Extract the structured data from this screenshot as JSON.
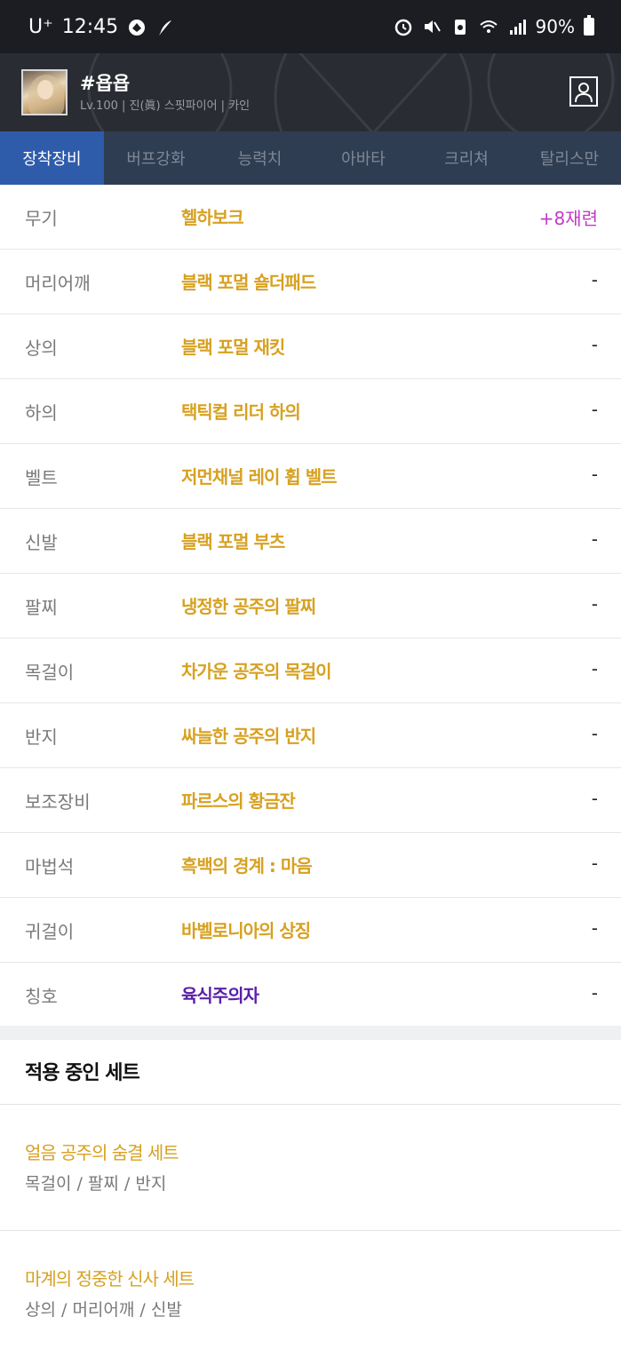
{
  "status_bar": {
    "carrier": "U⁺",
    "time": "12:45",
    "battery": "90%",
    "icons": [
      "signal-app-icon",
      "feather-icon",
      "alarm-icon",
      "mute-icon",
      "battery-saver-icon",
      "wifi-icon",
      "cell-signal-icon",
      "battery-icon"
    ]
  },
  "profile": {
    "name": "#욥욥",
    "info": "Lv.100 | 진(眞) 스핏파이어 | 카인"
  },
  "tabs": [
    {
      "label": "장착장비",
      "active": true
    },
    {
      "label": "버프강화",
      "active": false
    },
    {
      "label": "능력치",
      "active": false
    },
    {
      "label": "아바타",
      "active": false
    },
    {
      "label": "크리쳐",
      "active": false
    },
    {
      "label": "탈리스만",
      "active": false
    }
  ],
  "equipment": [
    {
      "slot": "무기",
      "item": "헬하보크",
      "tail": "+8재련"
    },
    {
      "slot": "머리어깨",
      "item": "블랙 포멀 숄더패드",
      "tail": "-"
    },
    {
      "slot": "상의",
      "item": "블랙 포멀 재킷",
      "tail": "-"
    },
    {
      "slot": "하의",
      "item": "택틱컬 리더 하의",
      "tail": "-"
    },
    {
      "slot": "벨트",
      "item": "저먼채널 레이 휩 벨트",
      "tail": "-"
    },
    {
      "slot": "신발",
      "item": "블랙 포멀 부츠",
      "tail": "-"
    },
    {
      "slot": "팔찌",
      "item": "냉정한 공주의 팔찌",
      "tail": "-"
    },
    {
      "slot": "목걸이",
      "item": "차가운 공주의 목걸이",
      "tail": "-"
    },
    {
      "slot": "반지",
      "item": "싸늘한 공주의 반지",
      "tail": "-"
    },
    {
      "slot": "보조장비",
      "item": "파르스의 황금잔",
      "tail": "-"
    },
    {
      "slot": "마법석",
      "item": "흑백의 경계 : 마음",
      "tail": "-"
    },
    {
      "slot": "귀걸이",
      "item": "바벨로니아의 상징",
      "tail": "-"
    },
    {
      "slot": "칭호",
      "item": "육식주의자",
      "tail": "-"
    }
  ],
  "sets": {
    "title": "적용 중인 세트",
    "items": [
      {
        "name": "얼음 공주의 숨결 세트",
        "parts": "목걸이 / 팔찌 / 반지"
      },
      {
        "name": "마계의 정중한 신사 세트",
        "parts": "상의 / 머리어깨 / 신발"
      }
    ]
  },
  "colors": {
    "rare_item": "#d7a121",
    "unique_item": "#5b1fa8",
    "refine": "#c23bc8",
    "active_tab": "#2f5bab",
    "tab_bar": "#2f3d52"
  }
}
